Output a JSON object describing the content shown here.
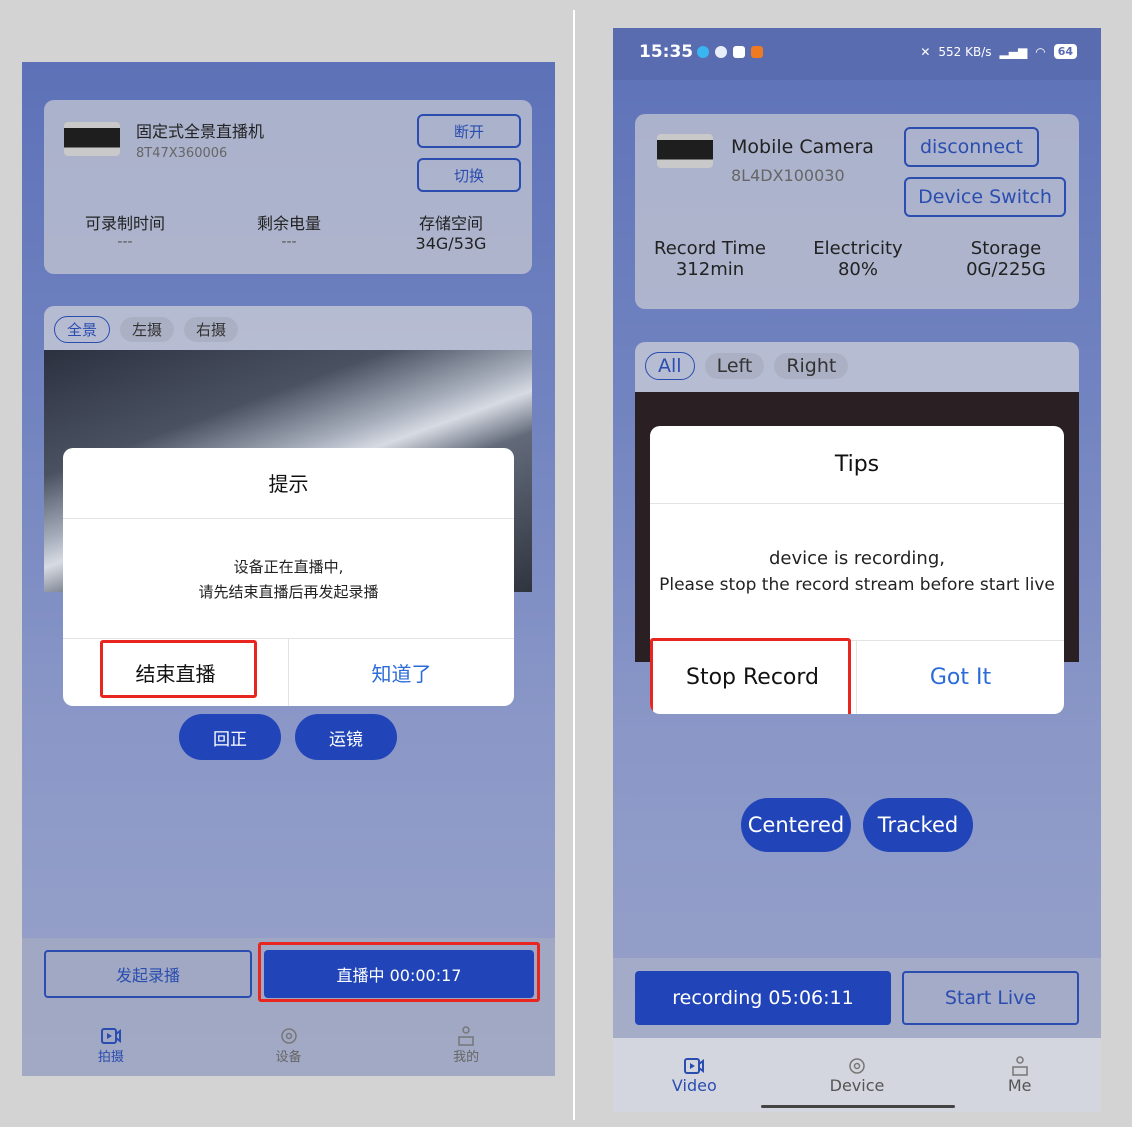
{
  "chinese": {
    "device": {
      "name": "固定式全景直播机",
      "serial": "8T47X360006"
    },
    "buttons": {
      "disconnect": "断开",
      "switch": "切换"
    },
    "stats": [
      {
        "label": "可录制时间",
        "value": "---"
      },
      {
        "label": "剩余电量",
        "value": "---"
      },
      {
        "label": "存储空间",
        "value": "34G/53G"
      }
    ],
    "tabs": [
      "全景",
      "左摄",
      "右摄"
    ],
    "dialog": {
      "title": "提示",
      "message_line1": "设备正在直播中,",
      "message_line2": "请先结束直播后再发起录播",
      "left_button": "结束直播",
      "right_button": "知道了"
    },
    "controls": {
      "center": "回正",
      "track": "运镜"
    },
    "actions": {
      "start_record": "发起录播",
      "live_status": "直播中 00:00:17"
    },
    "nav": [
      {
        "label": "拍摄",
        "icon": "video-icon"
      },
      {
        "label": "设备",
        "icon": "gear-icon"
      },
      {
        "label": "我的",
        "icon": "person-icon"
      }
    ]
  },
  "english": {
    "status_bar": {
      "time": "15:35",
      "speed": "552 KB/s",
      "battery": "64"
    },
    "device": {
      "name": "Mobile Camera",
      "serial": "8L4DX100030"
    },
    "buttons": {
      "disconnect": "disconnect",
      "switch": "Device Switch"
    },
    "stats": [
      {
        "label": "Record Time",
        "value": "312min"
      },
      {
        "label": "Electricity",
        "value": "80%"
      },
      {
        "label": "Storage",
        "value": "0G/225G"
      }
    ],
    "tabs": [
      "All",
      "Left",
      "Right"
    ],
    "dialog": {
      "title": "Tips",
      "message_line1": "device is recording,",
      "message_line2": "Please stop the record stream before start live",
      "left_button": "Stop Record",
      "right_button": "Got It"
    },
    "controls": {
      "center": "Centered",
      "track": "Tracked"
    },
    "actions": {
      "record_status": "recording 05:06:11",
      "start_live": "Start Live"
    },
    "nav": [
      {
        "label": "Video",
        "icon": "video-icon"
      },
      {
        "label": "Device",
        "icon": "gear-icon"
      },
      {
        "label": "Me",
        "icon": "person-icon"
      }
    ]
  },
  "colors": {
    "primary": "#2145b8",
    "highlight": "#e8251e",
    "accent_text": "#2b6bd8"
  }
}
